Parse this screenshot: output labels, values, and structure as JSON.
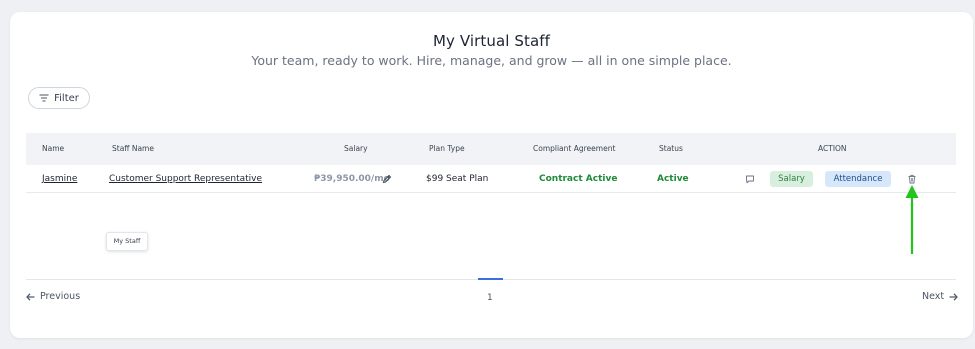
{
  "page": {
    "title": "My Virtual Staff",
    "subtitle": "Your team, ready to work. Hire, manage, and grow — all in one simple place."
  },
  "filter": {
    "label": "Filter",
    "icon": "filter-icon"
  },
  "table": {
    "headers": {
      "name": "Name",
      "staff_name": "Staff Name",
      "salary": "Salary",
      "plan_type": "Plan Type",
      "compliant_agreement": "Compliant Agreement",
      "status": "Status",
      "action": "ACTION"
    },
    "rows": [
      {
        "name": "Jasmine",
        "staff_name": "Customer Support Representative",
        "salary": "₱39,950.00/mo",
        "plan_type": "$99 Seat Plan",
        "compliant_agreement": "Contract Active",
        "status": "Active",
        "salary_button": "Salary",
        "attendance_button": "Attendance"
      }
    ]
  },
  "tooltip": {
    "text": "My Staff"
  },
  "pagination": {
    "previous": "Previous",
    "next": "Next",
    "current_page": "1"
  },
  "colors": {
    "active_green": "#1e8a3a",
    "salary_pill_bg": "#d9efdd",
    "attendance_pill_bg": "#d7e7fb",
    "annotation_arrow": "#22c41e",
    "pager_active": "#3b6fe0"
  }
}
